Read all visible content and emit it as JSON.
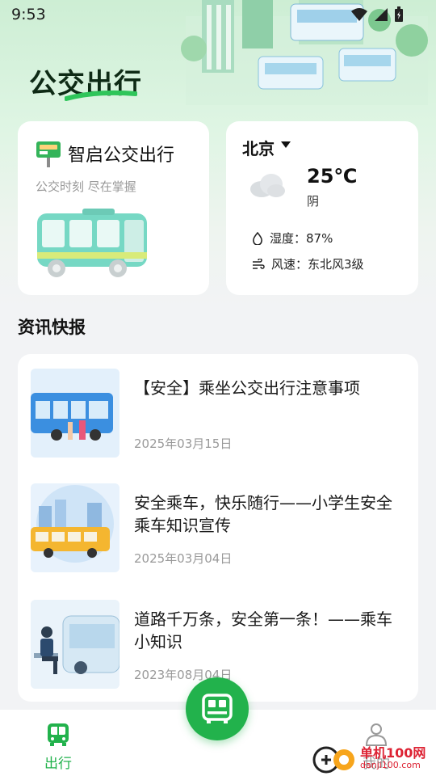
{
  "status_bar": {
    "time": "9:53"
  },
  "app": {
    "title": "公交出行"
  },
  "bus_card": {
    "title": "智启公交出行",
    "subtitle": "公交时刻 尽在掌握"
  },
  "weather": {
    "city": "北京",
    "temperature": "25℃",
    "condition": "阴",
    "humidity": "湿度：87%",
    "wind": "风速：东北风3级"
  },
  "news": {
    "section_title": "资讯快报",
    "items": [
      {
        "title": "【安全】乘坐公交出行注意事项",
        "date": "2025年03月15日"
      },
      {
        "title": "安全乘车，快乐随行——小学生安全乘车知识宣传",
        "date": "2025年03月04日"
      },
      {
        "title": "道路千万条，安全第一条！——乘车小知识",
        "date": "2023年08月04日"
      }
    ]
  },
  "bottom_nav": {
    "trip_label": "出行",
    "mine_label": "我的"
  },
  "watermark": {
    "text": "单机100网",
    "url": "danji100.com"
  },
  "colors": {
    "accent": "#22b24c",
    "title": "#0e2a15",
    "muted": "#999999"
  }
}
